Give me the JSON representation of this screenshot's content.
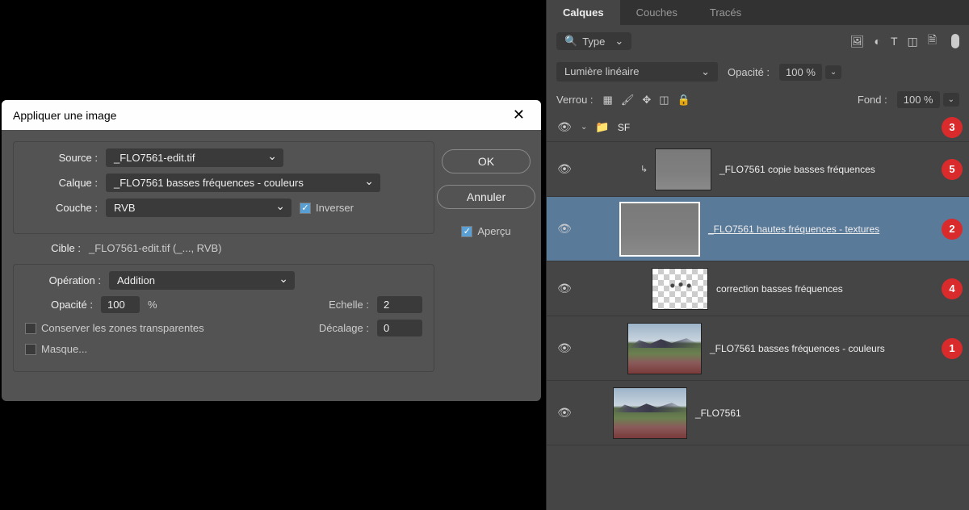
{
  "dialog": {
    "title": "Appliquer une image",
    "source_label": "Source :",
    "source_value": "_FLO7561-edit.tif",
    "layer_label": "Calque :",
    "layer_value": "_FLO7561 basses fréquences - couleurs",
    "channel_label": "Couche :",
    "channel_value": "RVB",
    "invert_label": "Inverser",
    "target_label": "Cible :",
    "target_value": "_FLO7561-edit.tif (_..., RVB)",
    "operation_label": "Opération :",
    "operation_value": "Addition",
    "opacity_label": "Opacité :",
    "opacity_value": "100",
    "opacity_unit": "%",
    "scale_label": "Echelle :",
    "scale_value": "2",
    "offset_label": "Décalage :",
    "offset_value": "0",
    "preserve_transparency": "Conserver les zones transparentes",
    "mask_label": "Masque...",
    "ok": "OK",
    "cancel": "Annuler",
    "preview": "Aperçu"
  },
  "panel": {
    "tabs": {
      "layers": "Calques",
      "channels": "Couches",
      "paths": "Tracés"
    },
    "type_filter": "Type",
    "blend_mode": "Lumière linéaire",
    "opacity_label": "Opacité :",
    "opacity_value": "100 %",
    "lock_label": "Verrou :",
    "fill_label": "Fond :",
    "fill_value": "100 %",
    "group_name": "SF",
    "layers": [
      {
        "name": "_FLO7561 copie basses fréquences",
        "badge": "5",
        "clipped": true,
        "thumb": "gray"
      },
      {
        "name": "_FLO7561 hautes fréquences - textures",
        "badge": "2",
        "selected": true,
        "thumb": "gray",
        "underlined": true
      },
      {
        "name": "correction basses fréquences",
        "badge": "4",
        "thumb": "checker"
      },
      {
        "name": "_FLO7561 basses fréquences - couleurs",
        "badge": "1",
        "thumb": "landscape"
      }
    ],
    "base_layer": "_FLO7561",
    "group_badge": "3"
  }
}
